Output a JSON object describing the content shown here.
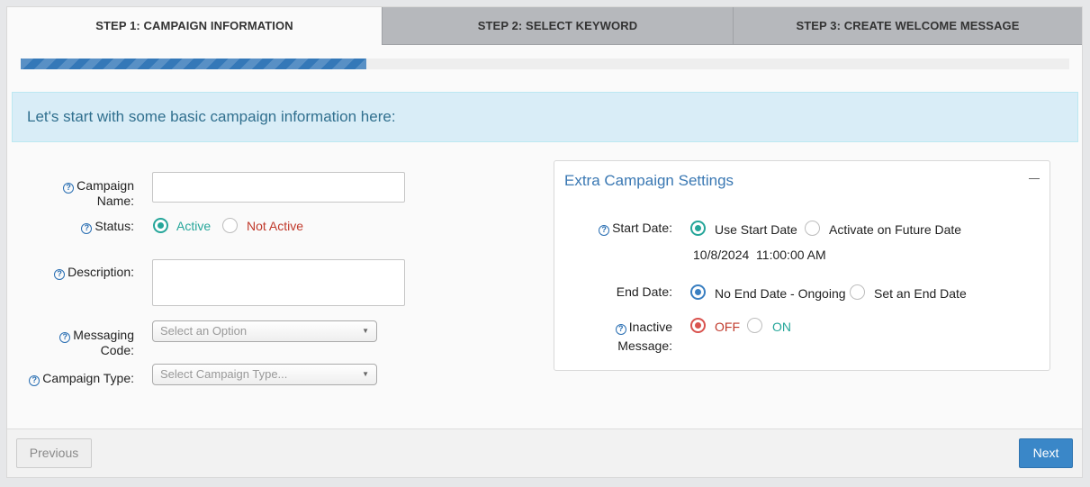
{
  "tabs": [
    {
      "label": "STEP 1: CAMPAIGN INFORMATION"
    },
    {
      "label": "STEP 2: SELECT KEYWORD"
    },
    {
      "label": "STEP 3: CREATE WELCOME MESSAGE"
    }
  ],
  "progress": {
    "fraction": 0.33
  },
  "intro": "Let's start with some basic campaign information here:",
  "form": {
    "campaign_name_label": "Campaign Name:",
    "campaign_name_value": "",
    "status_label": "Status:",
    "status_active": "Active",
    "status_not_active": "Not Active",
    "description_label": "Description:",
    "description_value": "",
    "messaging_code_label": "Messaging Code:",
    "messaging_code_placeholder": "Select an Option",
    "campaign_type_label": "Campaign Type:",
    "campaign_type_placeholder": "Select Campaign Type..."
  },
  "extra": {
    "title": "Extra Campaign Settings",
    "start_date_label": "Start Date:",
    "use_start_date": "Use Start Date",
    "activate_future": "Activate on Future Date",
    "start_datetime": "10/8/2024  11:00:00 AM",
    "end_date_label": "End Date:",
    "no_end_date": "No End Date - Ongoing",
    "set_end_date": "Set an End Date",
    "inactive_label_line1": "Inactive",
    "inactive_label_line2": "Message:",
    "off": "OFF",
    "on": "ON"
  },
  "footer": {
    "previous": "Previous",
    "next": "Next"
  },
  "icons": {
    "help": "?",
    "select_arrow": "▼"
  },
  "colors": {
    "teal": "#26a69a",
    "red": "#c0392b",
    "blue": "#2a6fb3"
  }
}
